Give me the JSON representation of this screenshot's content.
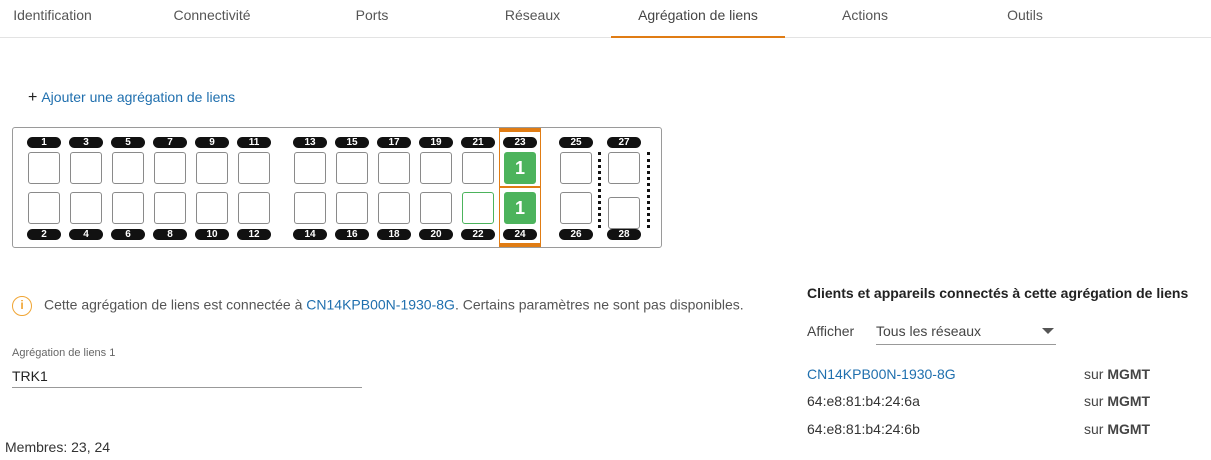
{
  "tabs": [
    {
      "label": "Identification",
      "active": false
    },
    {
      "label": "Connectivité",
      "active": false
    },
    {
      "label": "Ports",
      "active": false
    },
    {
      "label": "Réseaux",
      "active": false
    },
    {
      "label": "Agrégation de liens",
      "active": true
    },
    {
      "label": "Actions",
      "active": false
    },
    {
      "label": "Outils",
      "active": false
    }
  ],
  "add_link": {
    "icon": "plus-icon",
    "label": "Ajouter une agrégation de liens"
  },
  "switch": {
    "lag_member_badge": "1",
    "ports": [
      {
        "id": "1"
      },
      {
        "id": "2"
      },
      {
        "id": "3"
      },
      {
        "id": "4"
      },
      {
        "id": "5"
      },
      {
        "id": "6"
      },
      {
        "id": "7"
      },
      {
        "id": "8"
      },
      {
        "id": "9"
      },
      {
        "id": "10"
      },
      {
        "id": "11"
      },
      {
        "id": "12"
      },
      {
        "id": "13"
      },
      {
        "id": "14"
      },
      {
        "id": "15"
      },
      {
        "id": "16"
      },
      {
        "id": "17"
      },
      {
        "id": "18"
      },
      {
        "id": "19"
      },
      {
        "id": "20"
      },
      {
        "id": "21"
      },
      {
        "id": "22"
      },
      {
        "id": "23"
      },
      {
        "id": "24"
      },
      {
        "id": "25"
      },
      {
        "id": "26"
      },
      {
        "id": "27"
      },
      {
        "id": "28"
      }
    ],
    "lag_members": [
      "23",
      "24"
    ],
    "green_outline_ports": [
      "22"
    ],
    "colors": {
      "member": "#4cb35c",
      "lag_highlight": "#e07c14"
    }
  },
  "info": {
    "icon": "info-icon",
    "text_before": "Cette agrégation de liens est connectée à ",
    "link": "CN14KPB00N-1930-8G",
    "text_after": ". Certains paramètres ne sont pas disponibles."
  },
  "lag_field": {
    "label": "Agrégation de liens 1",
    "value": "TRK1"
  },
  "members_text": "Membres: 23, 24",
  "clients": {
    "title": "Clients et appareils connectés à cette agrégation de liens",
    "show_label": "Afficher",
    "filter_value": "Tous les réseaux",
    "rows": [
      {
        "name": "CN14KPB00N-1930-8G",
        "link": true,
        "prefix": "sur",
        "network": "MGMT"
      },
      {
        "name": "64:e8:81:b4:24:6a",
        "link": false,
        "prefix": "sur",
        "network": "MGMT"
      },
      {
        "name": "64:e8:81:b4:24:6b",
        "link": false,
        "prefix": "sur",
        "network": "MGMT"
      }
    ]
  }
}
